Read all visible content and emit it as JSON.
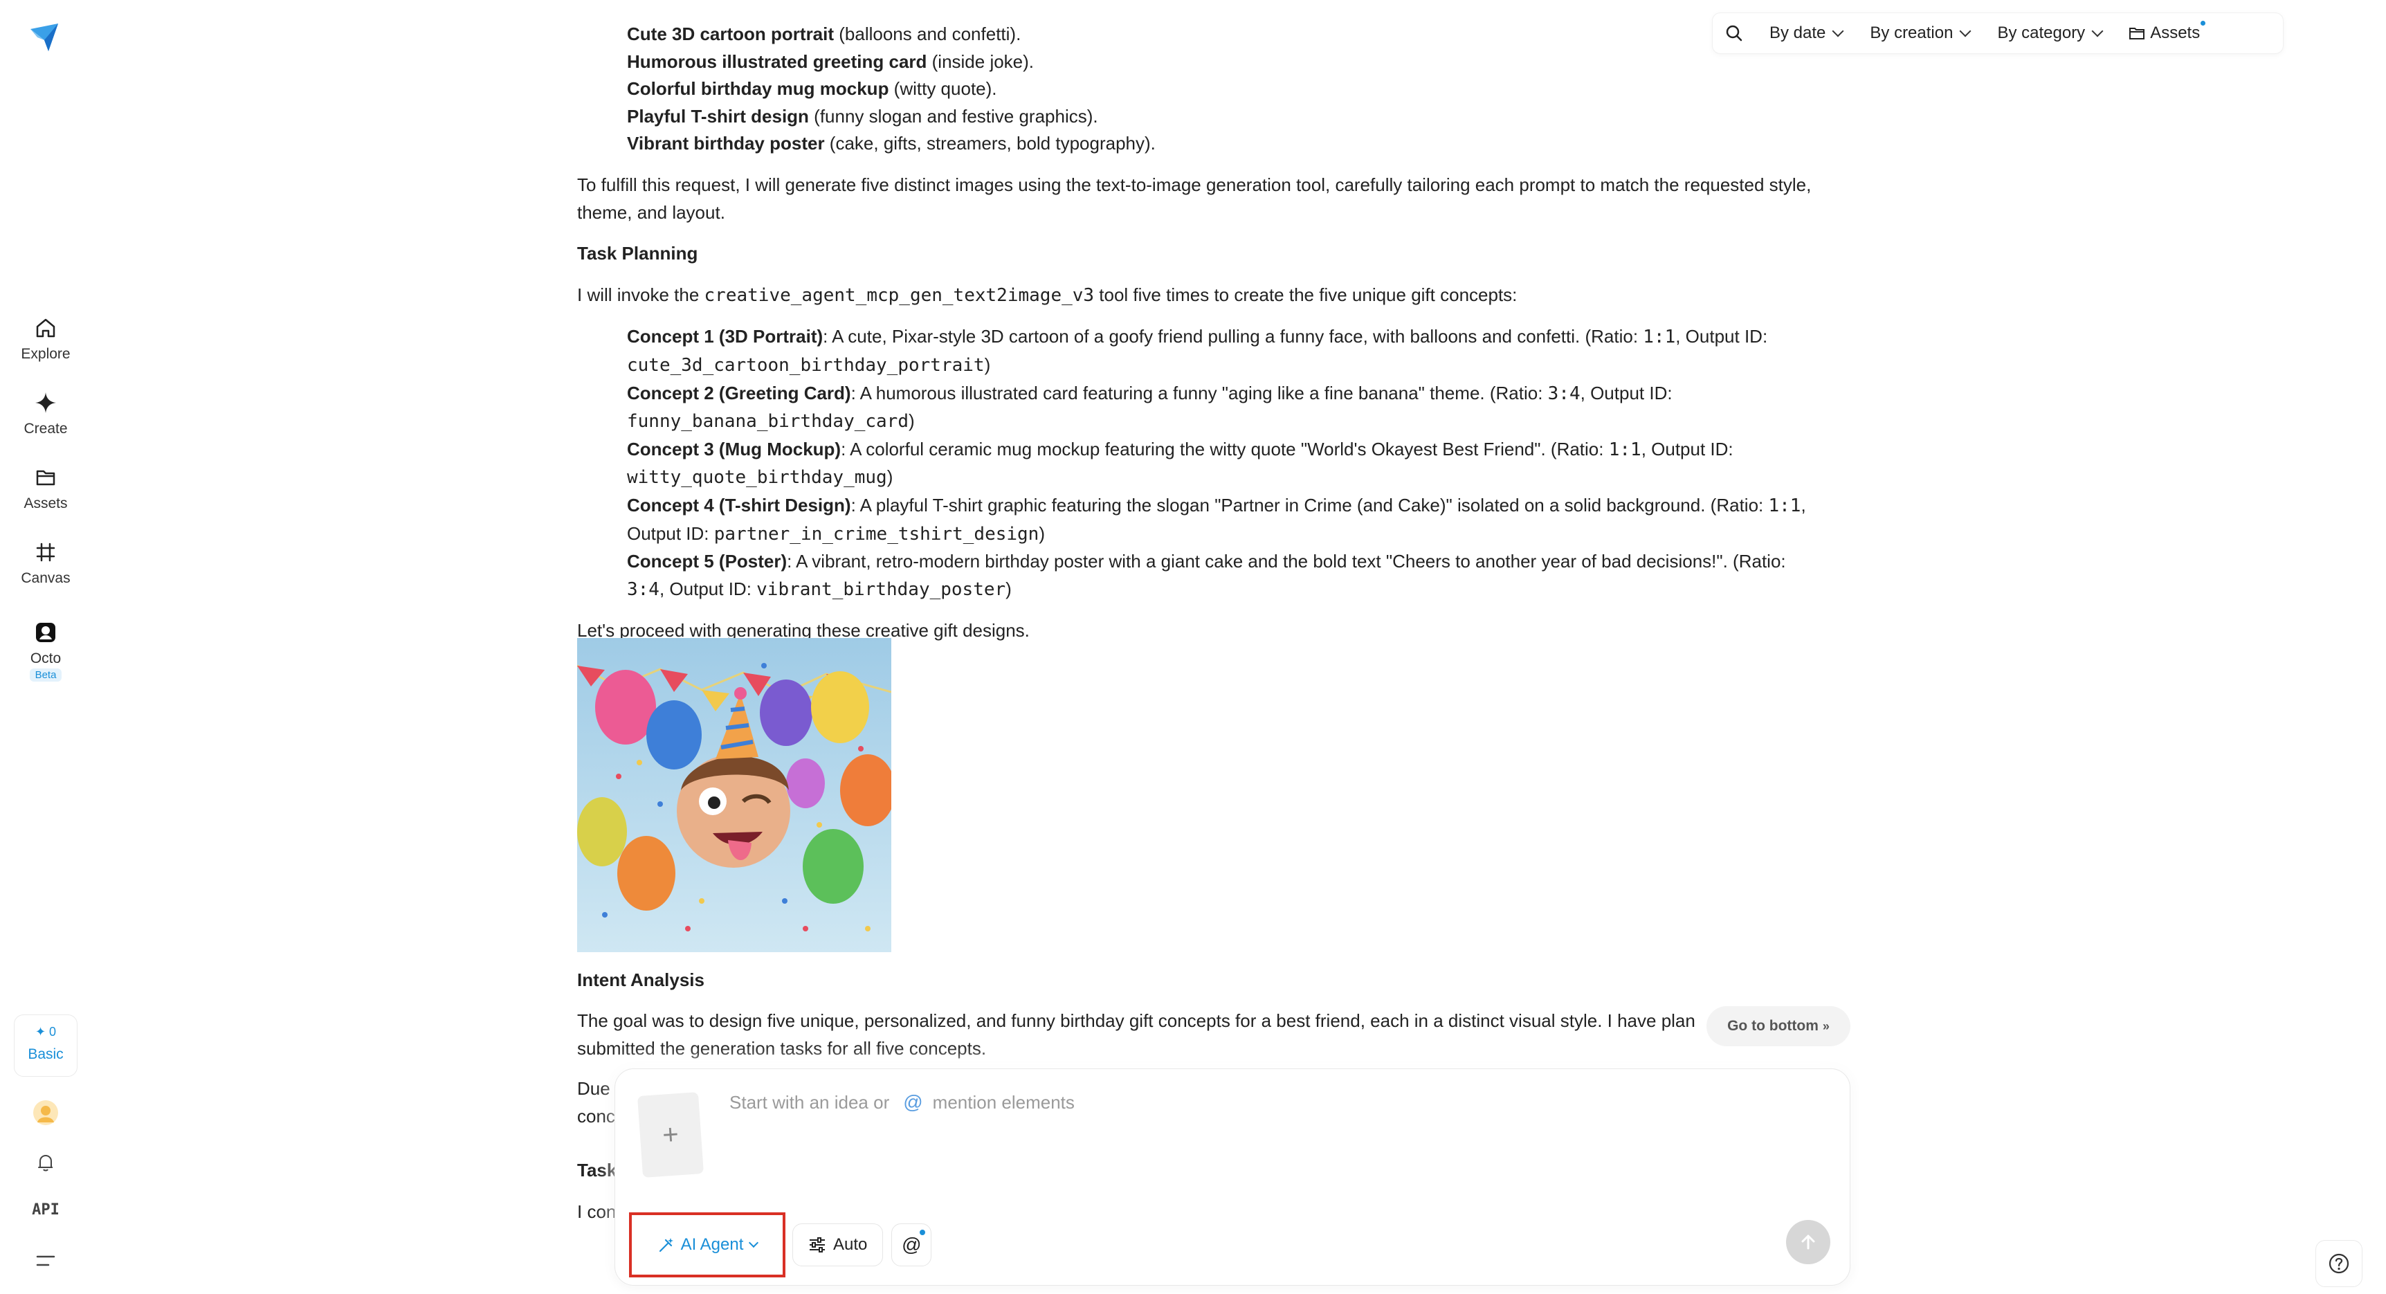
{
  "sidebar": {
    "nav": [
      {
        "label": "Explore",
        "icon": "home-icon"
      },
      {
        "label": "Create",
        "icon": "sparkle-icon"
      },
      {
        "label": "Assets",
        "icon": "folder-icon"
      },
      {
        "label": "Canvas",
        "icon": "canvas-icon"
      },
      {
        "label": "Octo",
        "icon": "octo-icon",
        "badge": "Beta"
      }
    ],
    "plan": {
      "credits": "0",
      "label": "Basic"
    },
    "api_label": "API"
  },
  "topbar": {
    "filters": [
      "By date",
      "By creation",
      "By category"
    ],
    "assets_label": "Assets"
  },
  "content": {
    "top_bullets": [
      {
        "bold": "Cute 3D cartoon portrait",
        "rest": " (balloons and confetti)."
      },
      {
        "bold": "Humorous illustrated greeting card",
        "rest": " (inside joke)."
      },
      {
        "bold": "Colorful birthday mug mockup",
        "rest": " (witty quote)."
      },
      {
        "bold": "Playful T-shirt design",
        "rest": " (funny slogan and festive graphics)."
      },
      {
        "bold": "Vibrant birthday poster",
        "rest": " (cake, gifts, streamers, bold typography)."
      }
    ],
    "fulfill_text": "To fulfill this request, I will generate five distinct images using the text-to-image generation tool, carefully tailoring each prompt to match the requested style, theme, and layout.",
    "task_planning_heading": "Task Planning",
    "invoke_pre": "I will invoke the ",
    "invoke_code": "creative_agent_mcp_gen_text2image_v3",
    "invoke_post": " tool five times to create the five unique gift concepts:",
    "concepts": [
      {
        "bold": "Concept 1 (3D Portrait)",
        "text": ": A cute, Pixar-style 3D cartoon of a goofy friend pulling a funny face, with balloons and confetti. (Ratio: ",
        "ratio": "1:1",
        "mid": ", Output ID:",
        "id": "cute_3d_cartoon_birthday_portrait",
        "end": ")"
      },
      {
        "bold": "Concept 2 (Greeting Card)",
        "text": ": A humorous illustrated card featuring a funny \"aging like a fine banana\" theme. (Ratio: ",
        "ratio": "3:4",
        "mid": ", Output ID:",
        "id": "funny_banana_birthday_card",
        "end": ")"
      },
      {
        "bold": "Concept 3 (Mug Mockup)",
        "text": ": A colorful ceramic mug mockup featuring the witty quote \"World's Okayest Best Friend\". (Ratio: ",
        "ratio": "1:1",
        "mid": ", Output ID:",
        "id": "witty_quote_birthday_mug",
        "end": ")"
      },
      {
        "bold": "Concept 4 (T-shirt Design)",
        "text": ": A playful T-shirt graphic featuring the slogan \"Partner in Crime (and Cake)\" isolated on a solid background. (Ratio: ",
        "ratio": "1:1",
        "mid": ",",
        "line2_prefix": "Output ID: ",
        "id": "partner_in_crime_tshirt_design",
        "end": ")"
      },
      {
        "bold": "Concept 5 (Poster)",
        "text": ": A vibrant, retro-modern birthday poster with a giant cake and the bold text \"Cheers to another year of bad decisions!\". (Ratio:",
        "ratio": "3:4",
        "mid": ", Output ID: ",
        "id": "vibrant_birthday_poster",
        "end": ")"
      }
    ],
    "proceed_text": "Let's proceed with generating these creative gift designs.",
    "intent_heading": "Intent Analysis",
    "intent_text_1": "The goal was to design five unique, personalized, and funny birthday gift concepts for a best friend, each in a distinct visual style. I have plan",
    "intent_text_2": "submitted the generation tasks for all five concepts.",
    "due_text_1": "Due",
    "due_text_2": "conc",
    "task_partial": "Task",
    "icon_partial": "I con"
  },
  "go_bottom_label": "Go to bottom",
  "composer": {
    "placeholder": "Start with an idea or",
    "mention_label": "mention elements",
    "agent_label": "AI Agent",
    "auto_label": "Auto"
  },
  "colors": {
    "accent": "#1a8fd8",
    "highlight_border": "#d93025"
  }
}
